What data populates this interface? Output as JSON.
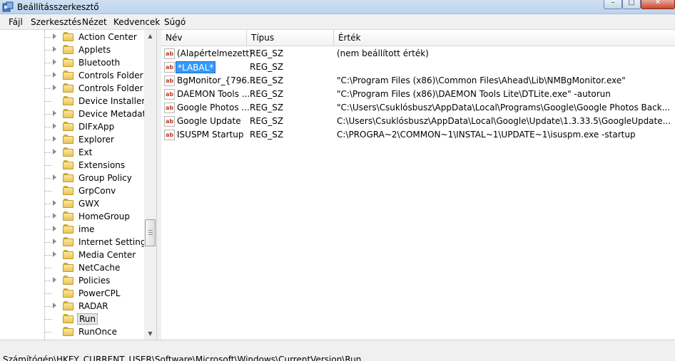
{
  "window": {
    "title": "Beállításszerkesztő"
  },
  "menu": [
    "Fájl",
    "Szerkesztés",
    "Nézet",
    "Kedvencek",
    "Súgó"
  ],
  "tree": {
    "items": [
      {
        "label": "Action Center",
        "expandable": true,
        "selected": false
      },
      {
        "label": "Applets",
        "expandable": true,
        "selected": false
      },
      {
        "label": "Bluetooth",
        "expandable": true,
        "selected": false
      },
      {
        "label": "Controls Folder",
        "expandable": true,
        "selected": false
      },
      {
        "label": "Controls Folder (W",
        "expandable": true,
        "selected": false
      },
      {
        "label": "Device Installer",
        "expandable": false,
        "selected": false
      },
      {
        "label": "Device Metadata",
        "expandable": true,
        "selected": false
      },
      {
        "label": "DIFxApp",
        "expandable": true,
        "selected": false
      },
      {
        "label": "Explorer",
        "expandable": true,
        "selected": false
      },
      {
        "label": "Ext",
        "expandable": true,
        "selected": false
      },
      {
        "label": "Extensions",
        "expandable": false,
        "selected": false
      },
      {
        "label": "Group Policy",
        "expandable": true,
        "selected": false
      },
      {
        "label": "GrpConv",
        "expandable": false,
        "selected": false
      },
      {
        "label": "GWX",
        "expandable": true,
        "selected": false
      },
      {
        "label": "HomeGroup",
        "expandable": true,
        "selected": false
      },
      {
        "label": "ime",
        "expandable": true,
        "selected": false
      },
      {
        "label": "Internet Settings",
        "expandable": true,
        "selected": false
      },
      {
        "label": "Media Center",
        "expandable": true,
        "selected": false
      },
      {
        "label": "NetCache",
        "expandable": false,
        "selected": false
      },
      {
        "label": "Policies",
        "expandable": true,
        "selected": false
      },
      {
        "label": "PowerCPL",
        "expandable": false,
        "selected": false
      },
      {
        "label": "RADAR",
        "expandable": true,
        "selected": false
      },
      {
        "label": "Run",
        "expandable": false,
        "selected": true
      },
      {
        "label": "RunOnce",
        "expandable": false,
        "selected": false
      }
    ]
  },
  "list": {
    "headers": {
      "name": "Név",
      "type": "Típus",
      "data": "Érték"
    },
    "rows": [
      {
        "name": "(Alapértelmezett)",
        "type": "REG_SZ",
        "data": "(nem beállított érték)",
        "editing": false
      },
      {
        "name": "*LABAL*",
        "type": "REG_SZ",
        "data": "",
        "editing": true
      },
      {
        "name": "BgMonitor_{796...",
        "type": "REG_SZ",
        "data": "\"C:\\Program Files (x86)\\Common Files\\Ahead\\Lib\\NMBgMonitor.exe\"",
        "editing": false
      },
      {
        "name": "DAEMON Tools ...",
        "type": "REG_SZ",
        "data": "\"C:\\Program Files (x86)\\DAEMON Tools Lite\\DTLite.exe\" -autorun",
        "editing": false
      },
      {
        "name": "Google Photos ...",
        "type": "REG_SZ",
        "data": "\"C:\\Users\\Csuklósbusz\\AppData\\Local\\Programs\\Google\\Google Photos Back...",
        "editing": false
      },
      {
        "name": "Google Update",
        "type": "REG_SZ",
        "data": "C:\\Users\\Csuklósbusz\\AppData\\Local\\Google\\Update\\1.3.33.5\\GoogleUpdate...",
        "editing": false
      },
      {
        "name": "ISUSPM Startup",
        "type": "REG_SZ",
        "data": "C:\\PROGRA~2\\COMMON~1\\INSTAL~1\\UPDATE~1\\isuspm.exe -startup",
        "editing": false
      }
    ],
    "value_icon": "ab"
  },
  "status": {
    "path": "Számítógép\\HKEY_CURRENT_USER\\Software\\Microsoft\\Windows\\CurrentVersion\\Run"
  },
  "colors": {
    "selection": "#3399ff",
    "folder": "#e9c45a"
  }
}
